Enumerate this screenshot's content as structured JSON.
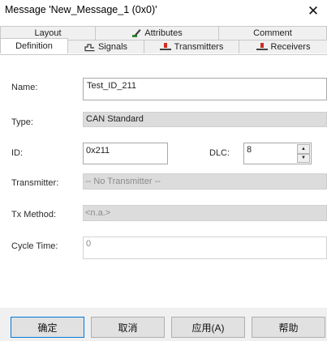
{
  "window": {
    "title": "Message 'New_Message_1 (0x0)'",
    "close_glyph": "✕"
  },
  "tabs": {
    "back_row": [
      {
        "label": "Layout",
        "icon": ""
      },
      {
        "label": "Attributes",
        "icon": "attributes-pencil-icon"
      },
      {
        "label": "Comment",
        "icon": ""
      }
    ],
    "front_row": [
      {
        "label": "Definition",
        "icon": "",
        "active": true
      },
      {
        "label": "Signals",
        "icon": "signals-icon"
      },
      {
        "label": "Transmitters",
        "icon": "transmitter-node-icon"
      },
      {
        "label": "Receivers",
        "icon": "receiver-node-icon"
      }
    ]
  },
  "form": {
    "name_label": "Name:",
    "name_value": "Test_ID_211",
    "type_label": "Type:",
    "type_value": "CAN Standard",
    "id_label": "ID:",
    "id_value": "0x211",
    "dlc_label": "DLC:",
    "dlc_value": "8",
    "transmitter_label": "Transmitter:",
    "transmitter_value": "-- No Transmitter --",
    "tx_method_label": "Tx Method:",
    "tx_method_value": "<n.a.>",
    "cycle_time_label": "Cycle Time:",
    "cycle_time_value": "0"
  },
  "footer": {
    "ok_label": "确定",
    "cancel_label": "取消",
    "apply_label": "应用(A)",
    "help_label": "帮助"
  },
  "colors": {
    "node_red": "#d42a1f",
    "accent_blue": "#0078d7"
  }
}
